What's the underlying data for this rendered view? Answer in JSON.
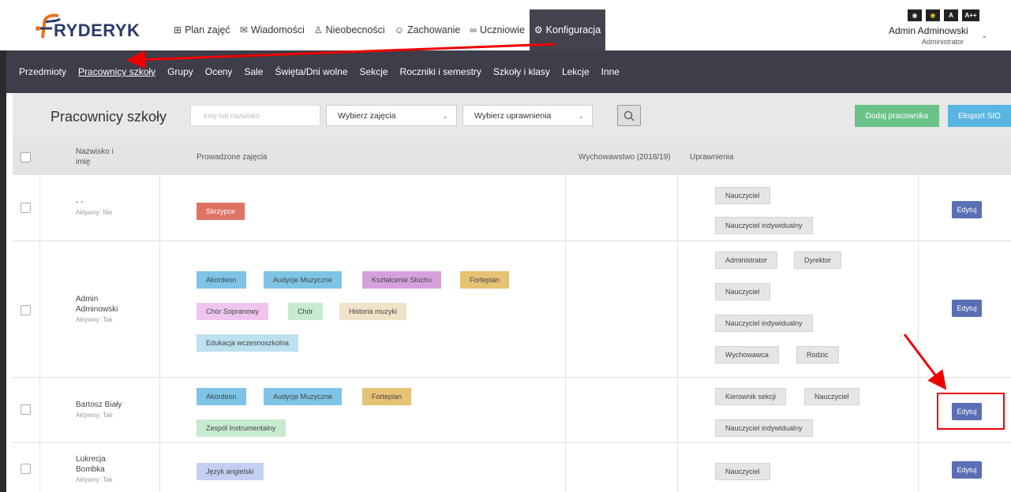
{
  "app": {
    "logo_text": "RYDERYK",
    "logo_initial": "F"
  },
  "nav": [
    {
      "label": "Plan zajęć",
      "icon": "calendar-icon"
    },
    {
      "label": "Wiadomości",
      "icon": "mail-icon"
    },
    {
      "label": "Nieobecności",
      "icon": "user-icon"
    },
    {
      "label": "Zachowanie",
      "icon": "smile-icon"
    },
    {
      "label": "Uczniowie",
      "icon": "users-icon"
    },
    {
      "label": "Konfiguracja",
      "icon": "gear-icon",
      "active": true
    }
  ],
  "accessibility": [
    "◉",
    "◉",
    "A",
    "A++"
  ],
  "user": {
    "name": "Admin Adminowski",
    "role": "Administrator"
  },
  "subnav": [
    "Przedmioty",
    "Pracownicy szkoły",
    "Grupy",
    "Oceny",
    "Sale",
    "Święta/Dni wolne",
    "Sekcje",
    "Roczniki i semestry",
    "Szkoły i klasy",
    "Lekcje",
    "Inne"
  ],
  "subnav_active": "Pracownicy szkoły",
  "page": {
    "title": "Pracownicy szkoły",
    "search_placeholder": "Imię lub nazwisko",
    "select_classes": "Wybierz zajęcia",
    "select_permissions": "Wybierz uprawnienia",
    "add_button": "Dodaj pracownika",
    "export_button": "Eksport SIO"
  },
  "table": {
    "headers": {
      "name_line1": "Nazwisko i",
      "name_line2": "imię",
      "classes": "Prowadzone zajęcia",
      "homeroom": "Wychowawstwo (2018/19)",
      "permissions": "Uprawnienia"
    },
    "edit_label": "Edytuj",
    "rows": [
      {
        "name1": "- -",
        "name2": "",
        "status": "Aktywny: Nie",
        "classes": [
          "Skrzypce"
        ],
        "permissions": [
          "Nauczyciel",
          "Nauczyciel indywidualny"
        ]
      },
      {
        "name1": "Admin",
        "name2": "Adminowski",
        "status": "Aktywny: Tak",
        "classes": [
          "Akordeon",
          "Audycje Muzyczne",
          "Kształcenie Słuchu",
          "Fortepian",
          "Chór Sopranowy",
          "Chór",
          "Historia muzyki",
          "Edukacja wczesnoszkolna"
        ],
        "permissions": [
          "Administrator",
          "Dyrektor",
          "Nauczyciel",
          "Nauczyciel indywidualny",
          "Wychowawca",
          "Rodzic"
        ]
      },
      {
        "name1": "Bartosz Biały",
        "name2": "",
        "status": "Aktywny: Tak",
        "classes": [
          "Akordeon",
          "Audycje Muzyczne",
          "Fortepian",
          "Zespół Instrumentalny"
        ],
        "permissions": [
          "Kierownik sekcji",
          "Nauczyciel",
          "Nauczyciel indywidualny"
        ]
      },
      {
        "name1": "Lukrecja",
        "name2": "Bombka",
        "status": "Aktywny: Tak",
        "classes": [
          "Język angielski"
        ],
        "permissions": [
          "Nauczyciel"
        ]
      }
    ]
  },
  "colors": {
    "primary_dark": "#3d3e49",
    "edit": "#5b6fb5",
    "add": "#6bc389",
    "export": "#59b5e2",
    "annotation": "#e00000"
  }
}
